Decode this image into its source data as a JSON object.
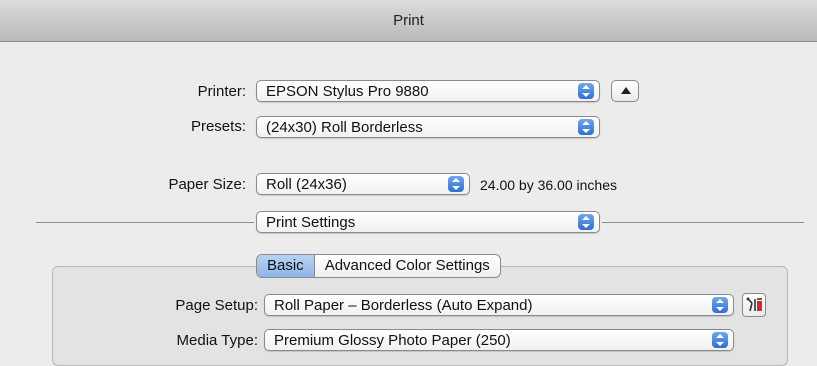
{
  "window": {
    "title": "Print"
  },
  "printer": {
    "label": "Printer:",
    "value": "EPSON Stylus Pro 9880"
  },
  "presets": {
    "label": "Presets:",
    "value": "(24x30) Roll Borderless"
  },
  "paper_size": {
    "label": "Paper Size:",
    "value": "Roll (24x36)",
    "dimensions": "24.00 by 36.00 inches"
  },
  "section": {
    "value": "Print Settings"
  },
  "tabs": [
    {
      "label": "Basic",
      "selected": true
    },
    {
      "label": "Advanced Color Settings",
      "selected": false
    }
  ],
  "page_setup": {
    "label": "Page Setup:",
    "value": "Roll Paper – Borderless (Auto Expand)"
  },
  "media_type": {
    "label": "Media Type:",
    "value": "Premium Glossy Photo Paper (250)"
  },
  "colors": {
    "accent": "#3a7bd8",
    "selected_tab": "#9cbef0",
    "window_bg": "#ececec"
  },
  "icons": {
    "disclosure": "triangle-up-icon",
    "tools": "tools-icon",
    "stepper": "updown-arrows-icon"
  }
}
